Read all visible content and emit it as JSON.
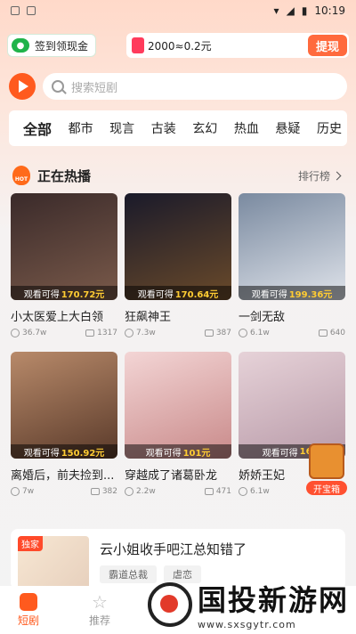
{
  "status": {
    "time": "10:19"
  },
  "topbar": {
    "signin_label": "签到领现金",
    "reward_text": "2000≈0.2元",
    "withdraw_label": "提现"
  },
  "search": {
    "placeholder": "搜索短剧"
  },
  "categories": [
    "全部",
    "都市",
    "现言",
    "古装",
    "玄幻",
    "热血",
    "悬疑",
    "历史"
  ],
  "section": {
    "title": "正在热播",
    "more": "排行榜"
  },
  "earn_prefix": "观看可得",
  "dramas": [
    {
      "name": "小太医爱上大白领",
      "earn": "170.72元",
      "views": "36.7w",
      "shares": "1317",
      "colors": [
        "#3a2a2a",
        "#7a5a4a"
      ]
    },
    {
      "name": "狂飙神王",
      "earn": "170.64元",
      "views": "7.3w",
      "shares": "387",
      "colors": [
        "#1a1a2a",
        "#6a4a2a"
      ]
    },
    {
      "name": "一剑无敌",
      "earn": "199.36元",
      "views": "6.1w",
      "shares": "640",
      "colors": [
        "#7a8aa0",
        "#dfe3ea"
      ]
    },
    {
      "name": "离婚后，前夫捡到...",
      "earn": "150.92元",
      "views": "7w",
      "shares": "382",
      "colors": [
        "#b88a6a",
        "#5a3a2a"
      ]
    },
    {
      "name": "穿越成了诸葛卧龙",
      "earn": "101元",
      "views": "2.2w",
      "shares": "471",
      "colors": [
        "#f3d5d5",
        "#c98a8a"
      ]
    },
    {
      "name": "娇娇王妃",
      "earn": "168.",
      "views": "6.1w",
      "shares": "",
      "colors": [
        "#e6d2d8",
        "#b89aa8"
      ]
    }
  ],
  "chest_label": "开宝箱",
  "feature": {
    "badge": "独家",
    "title": "云小姐收手吧江总知错了",
    "tags": [
      "霸道总裁",
      "虐恋"
    ]
  },
  "nav": {
    "tab1": "短剧",
    "tab2": "推荐"
  },
  "watermark": {
    "text": "国投新游网",
    "url": "www.sxsgytr.com"
  }
}
